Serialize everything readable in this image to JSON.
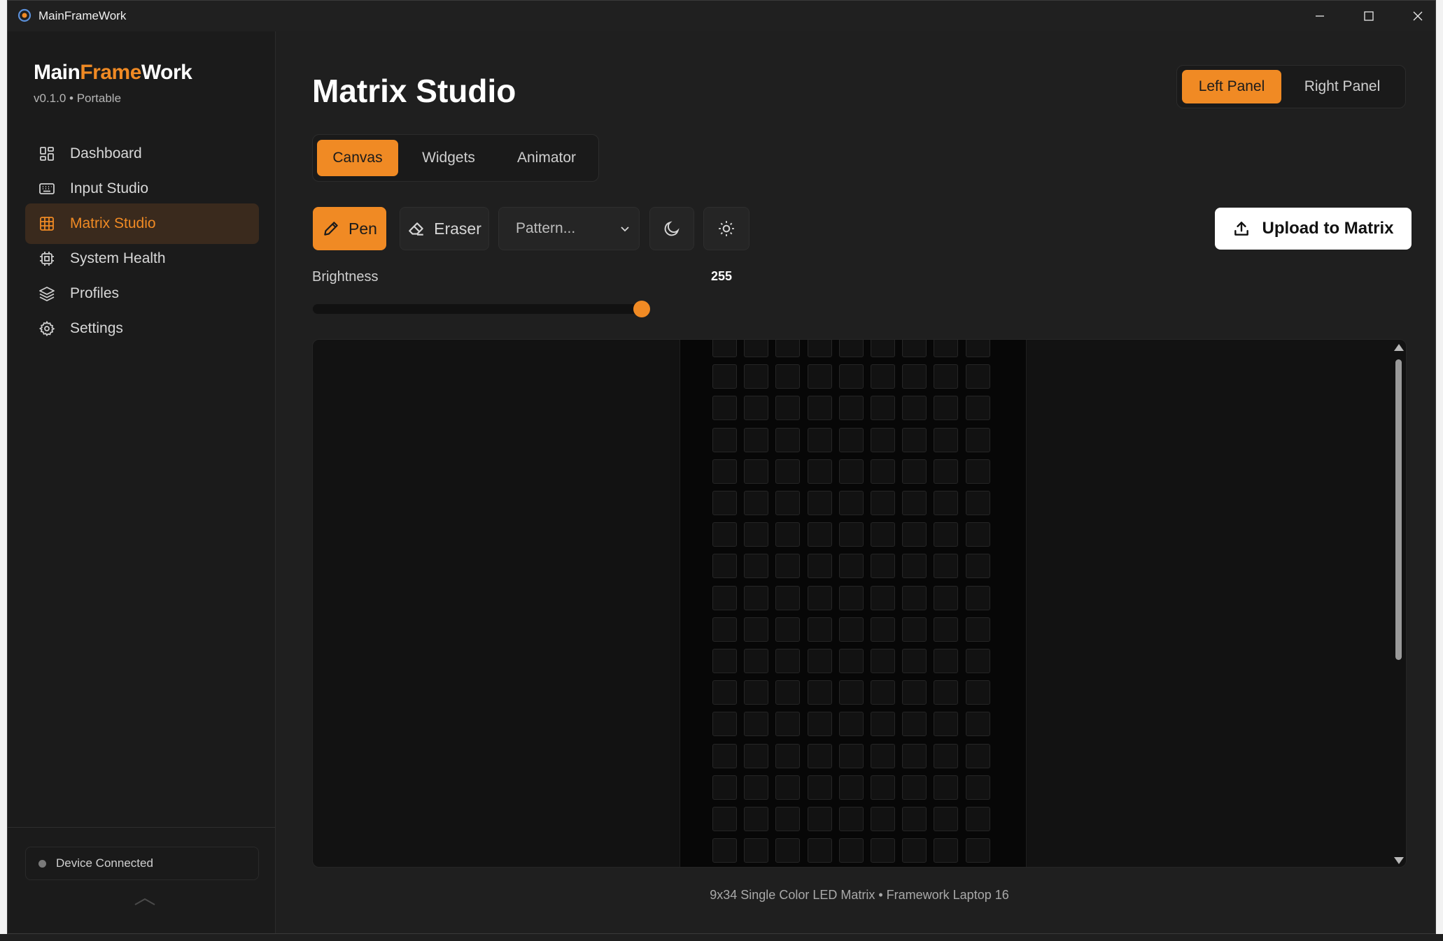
{
  "window": {
    "title": "MainFrameWork"
  },
  "sidebar": {
    "brand_parts": [
      "Main",
      "Frame",
      "Work"
    ],
    "version": "v0.1.0 • Portable",
    "items": [
      {
        "label": "Dashboard",
        "icon": "dashboard-icon",
        "active": false
      },
      {
        "label": "Input Studio",
        "icon": "keyboard-icon",
        "active": false
      },
      {
        "label": "Matrix Studio",
        "icon": "grid-icon",
        "active": true
      },
      {
        "label": "System Health",
        "icon": "cpu-icon",
        "active": false
      },
      {
        "label": "Profiles",
        "icon": "layers-icon",
        "active": false
      },
      {
        "label": "Settings",
        "icon": "gear-icon",
        "active": false
      }
    ],
    "status": {
      "label": "Device Connected",
      "dot_color": "#7a7a7a"
    }
  },
  "main": {
    "title": "Matrix Studio",
    "panel_toggle": {
      "left": "Left Panel",
      "right": "Right Panel",
      "selected": "Left Panel"
    },
    "tabs": [
      {
        "label": "Canvas",
        "active": true
      },
      {
        "label": "Widgets",
        "active": false
      },
      {
        "label": "Animator",
        "active": false
      }
    ],
    "tools": {
      "pen_label": "Pen",
      "eraser_label": "Eraser",
      "pattern_placeholder": "Pattern...",
      "active_tool": "Pen"
    },
    "upload_label": "Upload to Matrix",
    "brightness": {
      "label": "Brightness",
      "value": "255",
      "max": 255,
      "level": 1.0
    },
    "matrix": {
      "columns": 9,
      "rows": 34
    },
    "caption": "9x34 Single Color LED Matrix • Framework Laptop 16"
  },
  "colors": {
    "accent": "#f08a24",
    "background": "#1f1f1f",
    "sidebar": "#1b1b1b",
    "led_off": "#121212"
  }
}
